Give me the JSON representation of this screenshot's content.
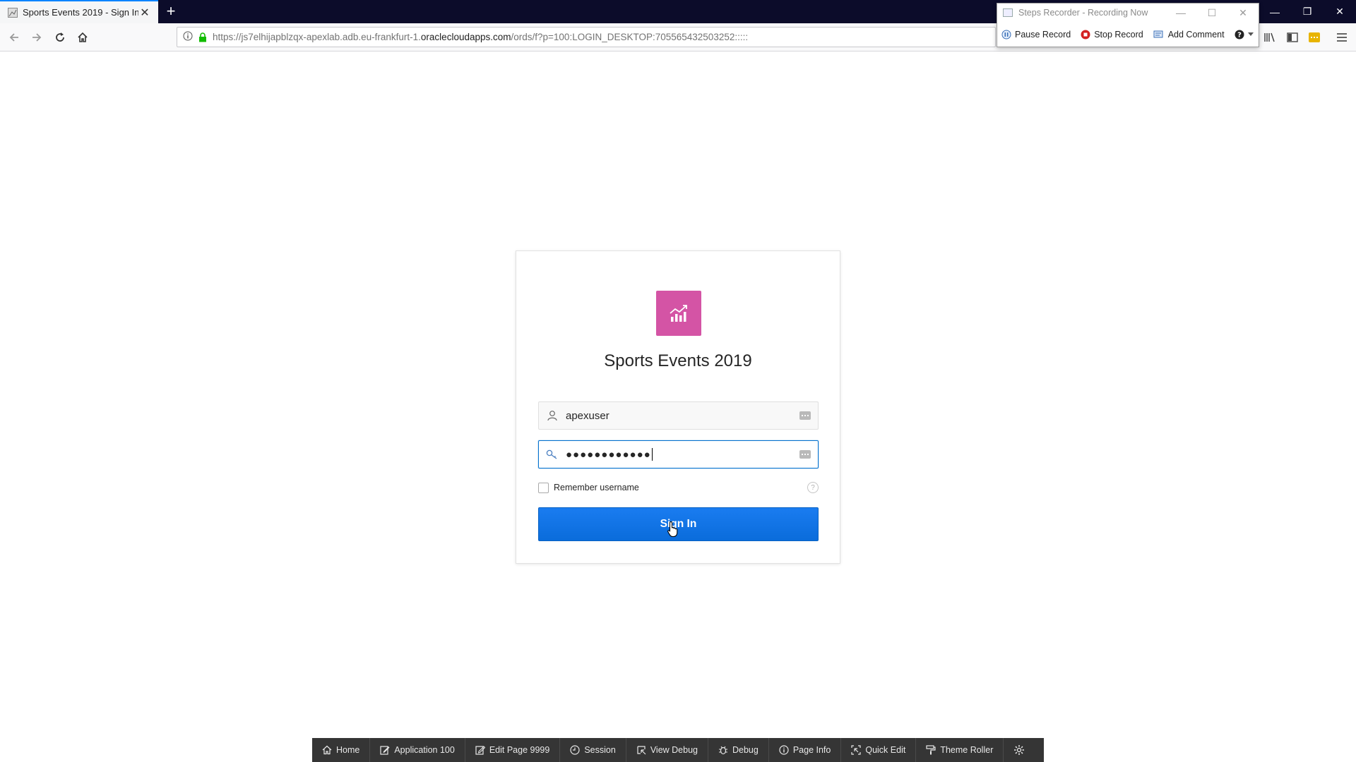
{
  "browser": {
    "tab_title": "Sports Events 2019 - Sign In",
    "url_prefix": "https://js7elhijapblzqx-apexlab.adb.eu-frankfurt-1.",
    "url_domain": "oraclecloudapps.com",
    "url_suffix": "/ords/f?p=100:LOGIN_DESKTOP:705565432503252:::::"
  },
  "steps_recorder": {
    "title": "Steps Recorder - Recording Now",
    "pause_label": "Pause Record",
    "stop_label": "Stop Record",
    "comment_label": "Add Comment"
  },
  "login": {
    "app_title": "Sports Events 2019",
    "username_value": "apexuser",
    "password_mask": "●●●●●●●●●●●●",
    "remember_label": "Remember username",
    "signin_label": "Sign In",
    "help_glyph": "?",
    "logo_color": "#d454a5",
    "button_color": "#0a6fdd"
  },
  "devbar": {
    "items": [
      {
        "label": "Home",
        "icon": "home-icon"
      },
      {
        "label": "Application 100",
        "icon": "edit-app-icon"
      },
      {
        "label": "Edit Page 9999",
        "icon": "edit-page-icon"
      },
      {
        "label": "Session",
        "icon": "clock-icon"
      },
      {
        "label": "View Debug",
        "icon": "view-debug-icon"
      },
      {
        "label": "Debug",
        "icon": "bug-icon"
      },
      {
        "label": "Page Info",
        "icon": "info-icon"
      },
      {
        "label": "Quick Edit",
        "icon": "quick-edit-icon"
      },
      {
        "label": "Theme Roller",
        "icon": "paint-roller-icon"
      }
    ]
  }
}
